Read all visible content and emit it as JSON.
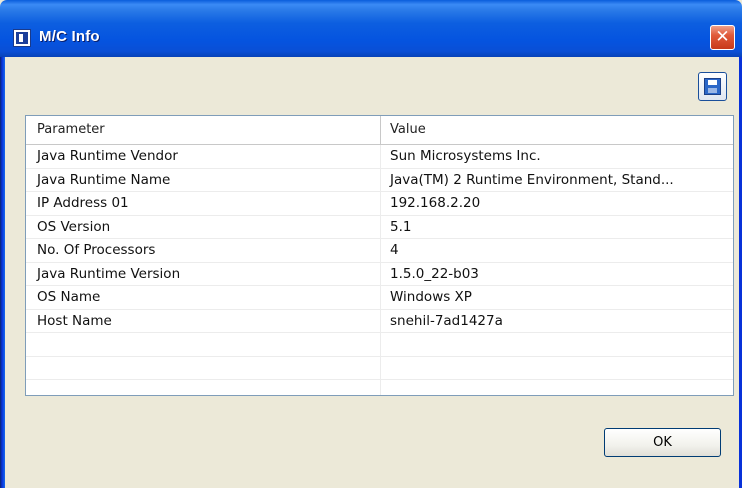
{
  "window": {
    "title": "M/C Info",
    "close_glyph": "✕"
  },
  "toolbar": {
    "save_icon": "save-icon"
  },
  "table": {
    "headers": [
      "Parameter",
      "Value"
    ],
    "rows": [
      [
        "Java Runtime Vendor",
        "Sun Microsystems Inc."
      ],
      [
        "Java Runtime Name",
        "Java(TM) 2 Runtime Environment, Stand..."
      ],
      [
        "IP Address 01",
        "192.168.2.20"
      ],
      [
        "OS Version",
        "5.1"
      ],
      [
        "No. Of Processors",
        "4"
      ],
      [
        "Java Runtime Version",
        "1.5.0_22-b03"
      ],
      [
        "OS Name",
        "Windows XP"
      ],
      [
        "Host Name",
        "snehil-7ad1427a"
      ],
      [
        "",
        ""
      ],
      [
        "",
        ""
      ],
      [
        "",
        ""
      ]
    ]
  },
  "buttons": {
    "ok_label": "OK"
  }
}
